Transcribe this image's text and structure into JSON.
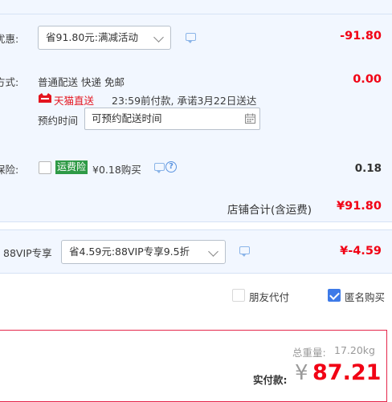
{
  "discount": {
    "label": "优惠:",
    "select_value": "省91.80元:满减活动",
    "amount": "-91.80"
  },
  "delivery": {
    "label": "方式:",
    "methods": "普通配送 快递 免邮",
    "tmall_badge": "天猫直送",
    "promise": "23:59前付款, 承诺3月22日送达",
    "schedule_label": "预约时间",
    "schedule_value": "可预约配送时间",
    "amount": "0.00"
  },
  "insurance": {
    "label": "保险:",
    "badge": "运费险",
    "price": "¥0.18购买",
    "amount": "0.18"
  },
  "store_total": {
    "label": "店铺合计(含运费)",
    "amount": "¥91.80"
  },
  "vip": {
    "label": "88VIP专享",
    "select_value": "省4.59元:88VIP专享9.5折",
    "amount": "¥-4.59"
  },
  "options": {
    "friend_pay": "朋友代付",
    "anonymous": "匿名购买",
    "friend_pay_checked": false,
    "anonymous_checked": true
  },
  "summary": {
    "weight_label": "总重量:",
    "weight_value": "17.20kg",
    "pay_label": "实付款:",
    "currency": "¥",
    "pay_amount": "87.21"
  },
  "colors": {
    "accent_red": "#f10215",
    "blue_bg": "#f2f7ff",
    "check_blue": "#3d7ae8",
    "insurance_green": "#2e9a46",
    "tmall_red": "#e4151f"
  }
}
